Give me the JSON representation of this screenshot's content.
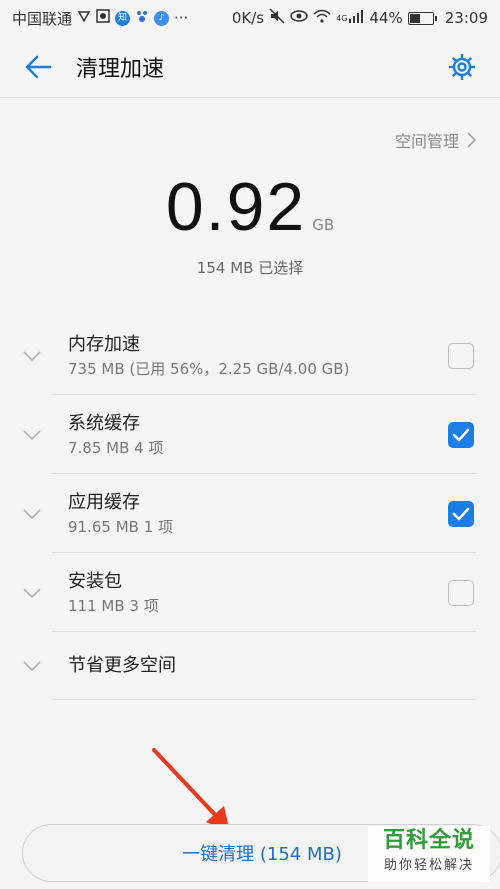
{
  "status_bar": {
    "carrier": "中国联通",
    "speed": "0K/s",
    "network": "4G",
    "battery": "44%",
    "time": "23:09",
    "app_icon_label": "知"
  },
  "header": {
    "title": "清理加速"
  },
  "space_link": {
    "label": "空间管理"
  },
  "summary": {
    "size": "0.92",
    "unit": "GB",
    "selected": "154 MB 已选择"
  },
  "items": [
    {
      "title": "内存加速",
      "subtitle": "735 MB (已用 56%，2.25 GB/4.00 GB)",
      "checked": false
    },
    {
      "title": "系统缓存",
      "subtitle": "7.85 MB   4 项",
      "checked": true
    },
    {
      "title": "应用缓存",
      "subtitle": "91.65 MB   1 项",
      "checked": true
    },
    {
      "title": "安装包",
      "subtitle": "111 MB   3 项",
      "checked": false
    },
    {
      "title": "节省更多空间"
    }
  ],
  "clean_button": {
    "label": "一键清理 (154 MB)"
  },
  "watermark": {
    "main": "百科全说",
    "sub": "助你轻松解决"
  },
  "colors": {
    "accent": "#1c7ee5",
    "annotation": "#e8391e",
    "watermark": "#2e9e3a"
  }
}
